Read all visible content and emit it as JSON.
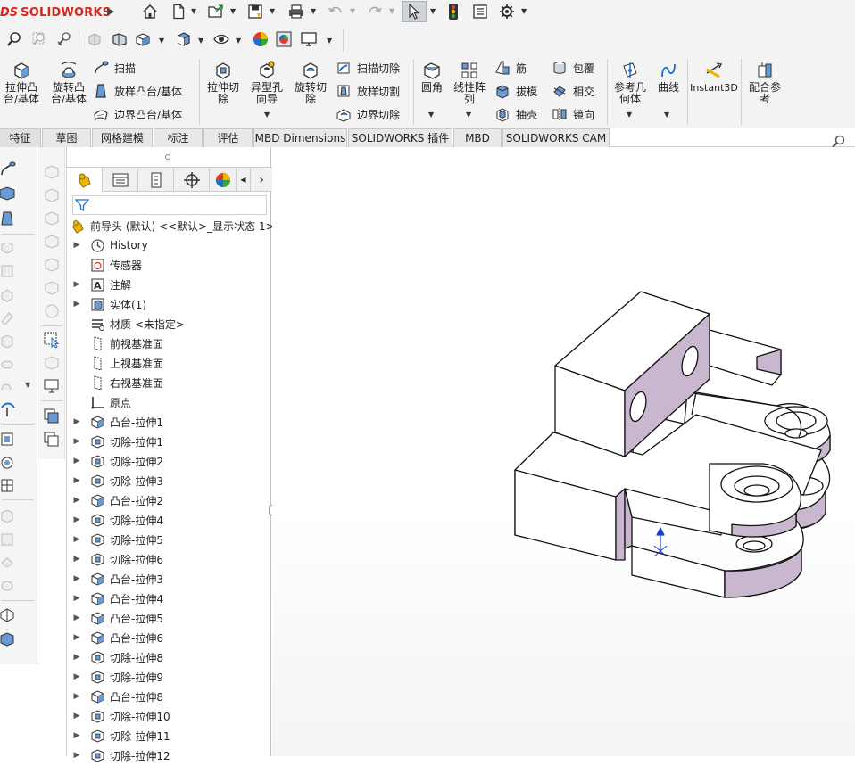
{
  "app": {
    "logo_ds": "DS",
    "logo_name": "SOLIDWORKS"
  },
  "quick_toolbar": {
    "icons": [
      "home-icon",
      "new-document-icon",
      "open-icon",
      "save-icon",
      "print-icon",
      "undo-icon",
      "redo-icon",
      "select-pointer-icon",
      "rebuild-icon",
      "file-properties-icon",
      "options-gear-icon"
    ]
  },
  "view_toolbar": {
    "icons": [
      "zoom-to-fit-icon",
      "zoom-area-icon",
      "previous-view-icon",
      "section-view-icon",
      "dynamic-annotation-icon",
      "view-orientation-icon",
      "display-style-icon",
      "hide-show-icon",
      "edit-appearance-icon",
      "apply-scene-icon",
      "view-settings-icon"
    ]
  },
  "ribbon": {
    "big": [
      {
        "label": "拉伸凸\n台/基体"
      },
      {
        "label": "旋转凸\n台/基体"
      },
      {
        "label": "拉伸切\n除"
      },
      {
        "label": "异型孔\n向导"
      },
      {
        "label": "旋转切\n除"
      },
      {
        "label": "圆角"
      },
      {
        "label": "线性阵\n列"
      },
      {
        "label": "参考几\n何体"
      },
      {
        "label": "曲线"
      },
      {
        "label": "Instant3D"
      },
      {
        "label": "配合参\n考"
      }
    ],
    "small": [
      {
        "label": "扫描"
      },
      {
        "label": "放样凸台/基体"
      },
      {
        "label": "边界凸台/基体"
      },
      {
        "label": "扫描切除"
      },
      {
        "label": "放样切割"
      },
      {
        "label": "边界切除"
      },
      {
        "label": "筋"
      },
      {
        "label": "拔模"
      },
      {
        "label": "抽壳"
      },
      {
        "label": "包覆"
      },
      {
        "label": "相交"
      },
      {
        "label": "镜向"
      }
    ]
  },
  "tabs": [
    {
      "label": "特征"
    },
    {
      "label": "草图"
    },
    {
      "label": "网格建模"
    },
    {
      "label": "标注"
    },
    {
      "label": "评估"
    },
    {
      "label": "MBD Dimensions"
    },
    {
      "label": "SOLIDWORKS 插件"
    },
    {
      "label": "MBD"
    },
    {
      "label": "SOLIDWORKS CAM"
    }
  ],
  "feature_tree": {
    "root": "前导头 (默认) <<默认>_显示状态 1>",
    "items": [
      {
        "label": "History",
        "type": "history",
        "expand": true
      },
      {
        "label": "传感器",
        "type": "sensor",
        "expand": false
      },
      {
        "label": "注解",
        "type": "annotation",
        "expand": true
      },
      {
        "label": "实体(1)",
        "type": "solid",
        "expand": true
      },
      {
        "label": "材质 <未指定>",
        "type": "material",
        "expand": false
      },
      {
        "label": "前视基准面",
        "type": "plane",
        "expand": false
      },
      {
        "label": "上视基准面",
        "type": "plane",
        "expand": false
      },
      {
        "label": "右视基准面",
        "type": "plane",
        "expand": false
      },
      {
        "label": "原点",
        "type": "origin",
        "expand": false
      },
      {
        "label": "凸台-拉伸1",
        "type": "boss",
        "expand": true
      },
      {
        "label": "切除-拉伸1",
        "type": "cut",
        "expand": true
      },
      {
        "label": "切除-拉伸2",
        "type": "cut",
        "expand": true
      },
      {
        "label": "切除-拉伸3",
        "type": "cut",
        "expand": true
      },
      {
        "label": "凸台-拉伸2",
        "type": "boss",
        "expand": true
      },
      {
        "label": "切除-拉伸4",
        "type": "cut",
        "expand": true
      },
      {
        "label": "切除-拉伸5",
        "type": "cut",
        "expand": true
      },
      {
        "label": "切除-拉伸6",
        "type": "cut",
        "expand": true
      },
      {
        "label": "凸台-拉伸3",
        "type": "boss",
        "expand": true
      },
      {
        "label": "凸台-拉伸4",
        "type": "boss",
        "expand": true
      },
      {
        "label": "凸台-拉伸5",
        "type": "boss",
        "expand": true
      },
      {
        "label": "凸台-拉伸6",
        "type": "boss",
        "expand": true
      },
      {
        "label": "切除-拉伸8",
        "type": "cut",
        "expand": true
      },
      {
        "label": "切除-拉伸9",
        "type": "cut",
        "expand": true
      },
      {
        "label": "凸台-拉伸8",
        "type": "boss",
        "expand": true
      },
      {
        "label": "切除-拉伸10",
        "type": "cut",
        "expand": true
      },
      {
        "label": "切除-拉伸11",
        "type": "cut",
        "expand": true
      },
      {
        "label": "切除-拉伸12",
        "type": "cut",
        "expand": true
      }
    ]
  },
  "colors": {
    "accent_red": "#d9261c",
    "part_face_purple": "#c9b6cf",
    "part_face_white": "#ffffff",
    "part_edge": "#111111",
    "triad_blue": "#1a3fd0"
  }
}
